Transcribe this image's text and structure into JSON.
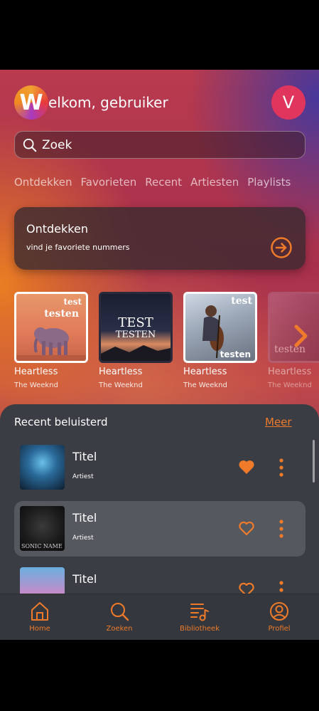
{
  "header": {
    "logo_letter": "W",
    "welcome": "elkom, gebruiker",
    "avatar_letter": "V"
  },
  "search": {
    "placeholder": "Zoek"
  },
  "tabs": [
    "Ontdekken",
    "Favorieten",
    "Recent",
    "Artiesten",
    "Playlists"
  ],
  "discover_card": {
    "title": "Ontdekken",
    "subtitle": "vind je favoriete nummers"
  },
  "albums": [
    {
      "title": "Heartless",
      "artist": "The Weeknd",
      "art_text": [
        "test",
        "testen"
      ]
    },
    {
      "title": "Heartless",
      "artist": "The Weeknd",
      "art_text": [
        "TEST",
        "TESTEN"
      ]
    },
    {
      "title": "Heartless",
      "artist": "The Weeknd",
      "art_text": [
        "test",
        "testen"
      ]
    },
    {
      "title": "Heartless",
      "artist": "The Weeknd",
      "art_text": [
        "testen"
      ]
    }
  ],
  "recent": {
    "title": "Recent beluisterd",
    "more_label": "Meer",
    "items": [
      {
        "title": "Titel",
        "artist": "Artiest",
        "liked": true
      },
      {
        "title": "Titel",
        "artist": "Artiest",
        "liked": false,
        "selected": true,
        "art_text": "SONIC NAME"
      },
      {
        "title": "Titel",
        "artist": "",
        "liked": false
      }
    ]
  },
  "nav": [
    {
      "label": "Home",
      "icon": "home-icon"
    },
    {
      "label": "Zoeken",
      "icon": "search-icon"
    },
    {
      "label": "Bibliotheek",
      "icon": "library-icon"
    },
    {
      "label": "Profiel",
      "icon": "profile-icon"
    }
  ],
  "colors": {
    "accent": "#ef7b2a",
    "avatar": "#e0365e",
    "panel": "#3a3d44",
    "nav": "#34373d"
  }
}
